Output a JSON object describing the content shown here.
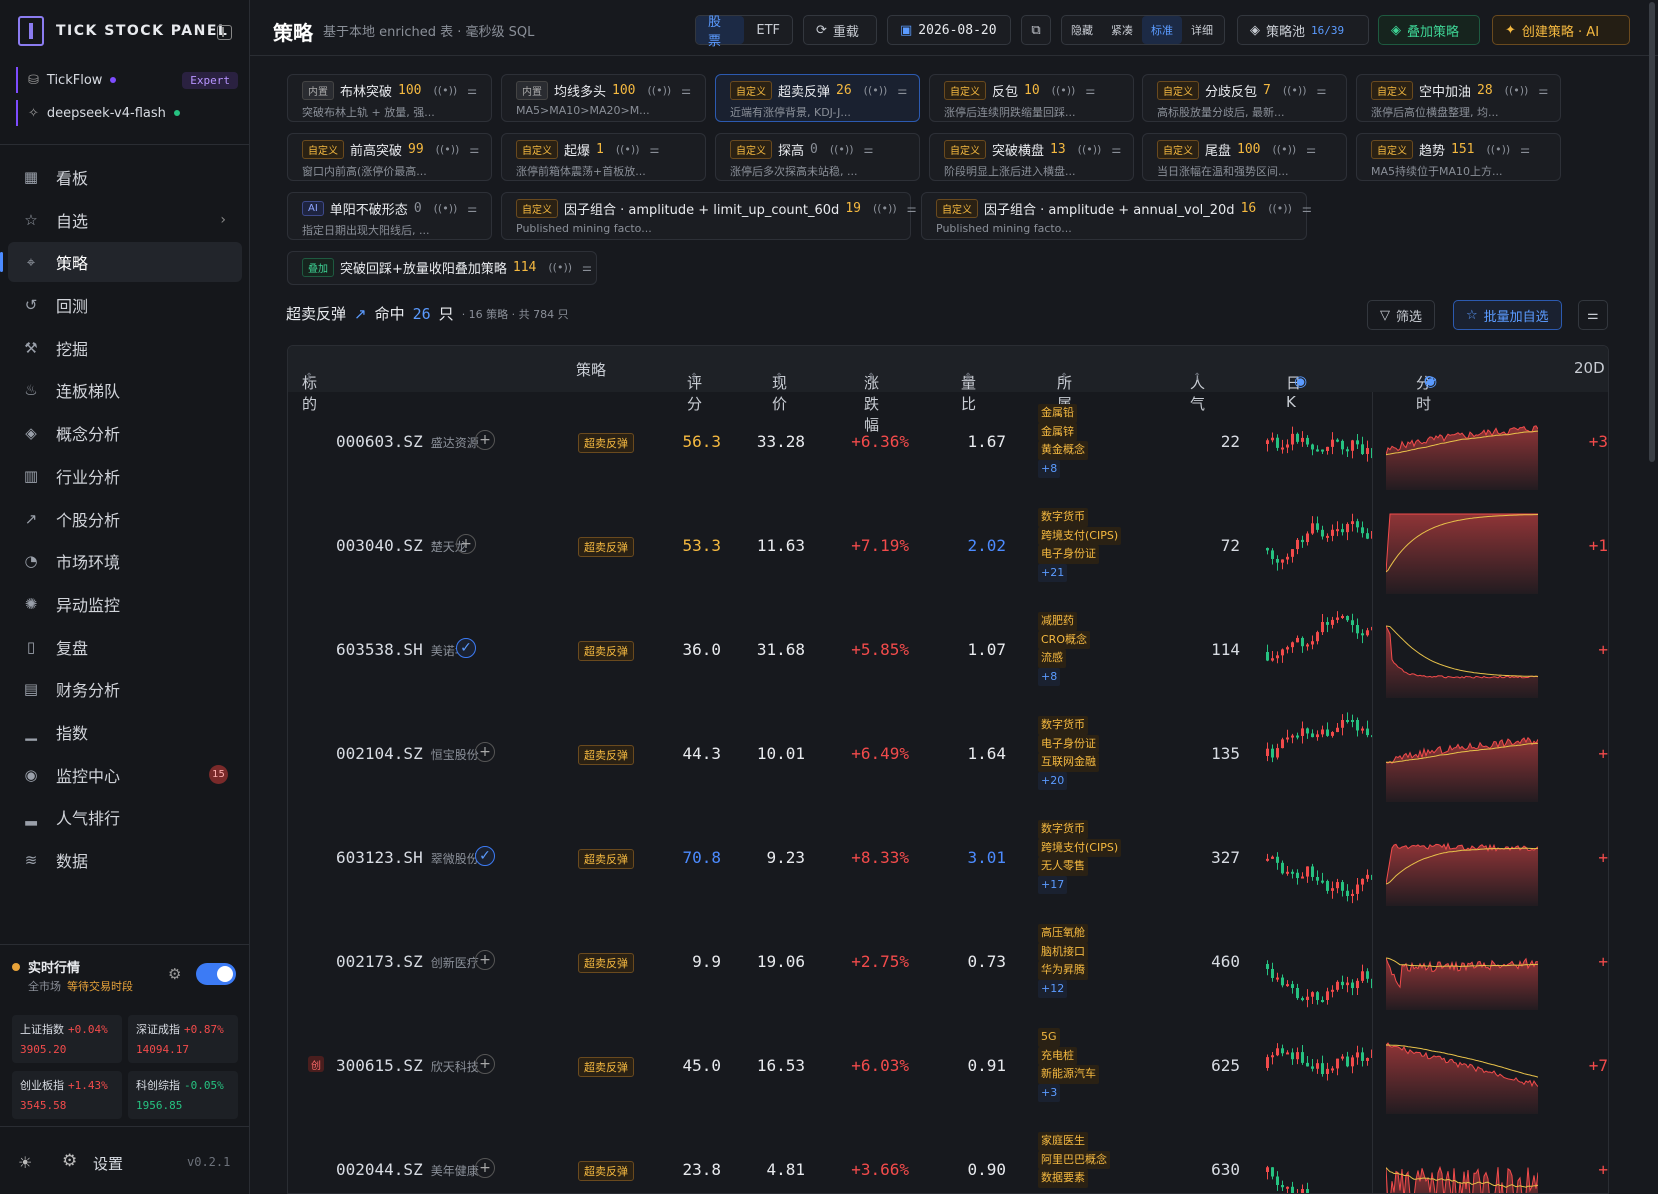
{
  "brand": "TICK STOCK PANEL",
  "accounts": [
    {
      "name": "TickFlow",
      "badge": "Expert",
      "dot": "#7d4cff"
    },
    {
      "name": "deepseek-v4-flash",
      "dot": "#26c281"
    }
  ],
  "nav": [
    {
      "label": "看板",
      "icon": "dashboard-icon",
      "glyph": "▦"
    },
    {
      "label": "自选",
      "icon": "star-icon",
      "glyph": "☆",
      "arrow": "›"
    },
    {
      "label": "策略",
      "icon": "strategy-icon",
      "glyph": "⌖",
      "active": true
    },
    {
      "label": "回测",
      "icon": "history-icon",
      "glyph": "↺"
    },
    {
      "label": "挖掘",
      "icon": "pickaxe-icon",
      "glyph": "⚒"
    },
    {
      "label": "连板梯队",
      "icon": "flame-icon",
      "glyph": "♨"
    },
    {
      "label": "概念分析",
      "icon": "layers-icon",
      "glyph": "◈"
    },
    {
      "label": "行业分析",
      "icon": "building-icon",
      "glyph": "▥"
    },
    {
      "label": "个股分析",
      "icon": "trend-icon",
      "glyph": "↗"
    },
    {
      "label": "市场环境",
      "icon": "gauge-icon",
      "glyph": "◔"
    },
    {
      "label": "异动监控",
      "icon": "alert-icon",
      "glyph": "✺"
    },
    {
      "label": "复盘",
      "icon": "book-icon",
      "glyph": "▯"
    },
    {
      "label": "财务分析",
      "icon": "document-icon",
      "glyph": "▤"
    },
    {
      "label": "指数",
      "icon": "bar-chart-icon",
      "glyph": "▁"
    },
    {
      "label": "监控中心",
      "icon": "radar-icon",
      "glyph": "◉",
      "count": "15"
    },
    {
      "label": "人气排行",
      "icon": "ranking-icon",
      "glyph": "▂"
    },
    {
      "label": "数据",
      "icon": "database-icon",
      "glyph": "≋"
    }
  ],
  "live": {
    "title": "实时行情",
    "scope": "全市场",
    "status": "等待交易时段"
  },
  "indices": [
    {
      "name": "上证指数",
      "chg": "+0.04%",
      "val": "3905.20",
      "color": "#f24b4b"
    },
    {
      "name": "深证成指",
      "chg": "+0.87%",
      "val": "14094.17",
      "color": "#f24b4b"
    },
    {
      "name": "创业板指",
      "chg": "+1.43%",
      "val": "3545.58",
      "color": "#f24b4b"
    },
    {
      "name": "科创综指",
      "chg": "-0.05%",
      "val": "1956.85",
      "color": "#26c281"
    }
  ],
  "footer": {
    "settings": "设置",
    "version": "v0.2.1"
  },
  "topbar": {
    "title": "策略",
    "subtitle": "基于本地 enriched 表 · 毫秒级 SQL",
    "seg_stock": "股票",
    "seg_etf": "ETF",
    "reload": "重载",
    "date": "2026-08-20",
    "density": [
      "隐藏",
      "紧凑",
      "标准",
      "详细"
    ],
    "pool_label": "策略池",
    "pool_count": "16/39",
    "overlay": "叠加策略",
    "create": "创建策略 · AI"
  },
  "cards": [
    {
      "tag": "内置",
      "name": "布林突破",
      "num": "100",
      "desc": "突破布林上轨 + 放量, 强..."
    },
    {
      "tag": "内置",
      "name": "均线多头",
      "num": "100",
      "desc": "MA5>MA10>MA20>M..."
    },
    {
      "tag": "自定义",
      "name": "超卖反弹",
      "num": "26",
      "desc": "近端有涨停背景, KDJ-J..."
    },
    {
      "tag": "自定义",
      "name": "反包",
      "num": "10",
      "desc": "涨停后连续阴跌缩量回踩..."
    },
    {
      "tag": "自定义",
      "name": "分歧反包",
      "num": "7",
      "desc": "高标股放量分歧后, 最新..."
    },
    {
      "tag": "自定义",
      "name": "空中加油",
      "num": "28",
      "desc": "涨停后高位横盘整理, 均..."
    },
    {
      "tag": "自定义",
      "name": "前高突破",
      "num": "99",
      "desc": "窗口内前高(涨停价最高..."
    },
    {
      "tag": "自定义",
      "name": "起爆",
      "num": "1",
      "desc": "涨停前箱体震荡+首板放..."
    },
    {
      "tag": "自定义",
      "name": "探高",
      "num": "0",
      "desc": "涨停后多次探高未站稳, ..."
    },
    {
      "tag": "自定义",
      "name": "突破横盘",
      "num": "13",
      "desc": "阶段明显上涨后进入横盘..."
    },
    {
      "tag": "自定义",
      "name": "尾盘",
      "num": "100",
      "desc": "当日涨幅在温和强势区间..."
    },
    {
      "tag": "自定义",
      "name": "趋势",
      "num": "151",
      "desc": "MA5持续位于MA10上方..."
    },
    {
      "tag": "AI",
      "name": "单阳不破形态",
      "num": "0",
      "desc": "指定日期出现大阳线后, ..."
    },
    {
      "tag": "自定义",
      "name": "因子组合 · amplitude + limit_up_count_60d",
      "num": "19",
      "desc": "Published mining facto..."
    },
    {
      "tag": "自定义",
      "name": "因子组合 · amplitude + annual_vol_20d",
      "num": "16",
      "desc": "Published mining facto..."
    },
    {
      "tag": "叠加",
      "name": "突破回踩+放量收阳叠加策略",
      "num": "114",
      "desc": ""
    }
  ],
  "hit": {
    "strategy": "超卖反弹",
    "label": "命中",
    "count": "26",
    "unit": "只",
    "meta": "· 16 策略 · 共 784 只",
    "filter": "筛选",
    "batch": "批量加自选"
  },
  "columns": [
    "标的",
    "策略",
    "评分",
    "现价",
    "涨跌幅",
    "量比",
    "所属概念",
    "人气",
    "日K",
    "分时",
    "20D"
  ],
  "rows": [
    {
      "code": "000603.SZ",
      "name": "盛达资源",
      "mark": "plus",
      "strat": "超卖反弹",
      "score": "56.3",
      "scoreColor": "#f5b940",
      "price": "33.28",
      "chg": "+6.36%",
      "vr": "1.67",
      "vrColor": "#e8eaee",
      "concepts": [
        "金属铅",
        "金属锌",
        "黄金概念"
      ],
      "more": "+8",
      "pop": "22",
      "d20": "+3",
      "intra": "up"
    },
    {
      "code": "003040.SZ",
      "name": "楚天龙",
      "mark": "plus",
      "strat": "超卖反弹",
      "score": "53.3",
      "scoreColor": "#f5b940",
      "price": "11.63",
      "chg": "+7.19%",
      "vr": "2.02",
      "vrColor": "#4c8bff",
      "concepts": [
        "数字货币",
        "跨境支付(CIPS)",
        "电子身份证"
      ],
      "more": "+21",
      "pop": "72",
      "d20": "+1",
      "intra": "limit"
    },
    {
      "code": "603538.SH",
      "name": "美诺华",
      "mark": "check",
      "strat": "超卖反弹",
      "score": "36.0",
      "scoreColor": "#e8eaee",
      "price": "31.68",
      "chg": "+5.85%",
      "vr": "1.07",
      "vrColor": "#e8eaee",
      "concepts": [
        "减肥药",
        "CRO概念",
        "流感"
      ],
      "more": "+8",
      "pop": "114",
      "d20": "+",
      "intra": "spike"
    },
    {
      "code": "002104.SZ",
      "name": "恒宝股份",
      "mark": "plus",
      "strat": "超卖反弹",
      "score": "44.3",
      "scoreColor": "#e8eaee",
      "price": "10.01",
      "chg": "+6.49%",
      "vr": "1.64",
      "vrColor": "#e8eaee",
      "concepts": [
        "数字货币",
        "电子身份证",
        "互联网金融"
      ],
      "more": "+20",
      "pop": "135",
      "d20": "+",
      "intra": "up"
    },
    {
      "code": "603123.SH",
      "name": "翠微股份",
      "mark": "check",
      "strat": "超卖反弹",
      "score": "70.8",
      "scoreColor": "#4c8bff",
      "price": "9.23",
      "chg": "+8.33%",
      "vr": "3.01",
      "vrColor": "#4c8bff",
      "concepts": [
        "数字货币",
        "跨境支付(CIPS)",
        "无人零售"
      ],
      "more": "+17",
      "pop": "327",
      "d20": "+",
      "intra": "flat"
    },
    {
      "code": "002173.SZ",
      "name": "创新医疗",
      "mark": "plus",
      "strat": "超卖反弹",
      "score": "9.9",
      "scoreColor": "#e8eaee",
      "price": "19.06",
      "chg": "+2.75%",
      "vr": "0.73",
      "vrColor": "#e8eaee",
      "concepts": [
        "高压氧舱",
        "脑机接口",
        "华为昇腾"
      ],
      "more": "+12",
      "pop": "460",
      "d20": "+",
      "intra": "dip"
    },
    {
      "code": "300615.SZ",
      "name": "欣天科技",
      "mark": "plus",
      "chuang": "创",
      "strat": "超卖反弹",
      "score": "45.0",
      "scoreColor": "#e8eaee",
      "price": "16.53",
      "chg": "+6.03%",
      "vr": "0.91",
      "vrColor": "#e8eaee",
      "concepts": [
        "5G",
        "充电桩",
        "新能源汽车"
      ],
      "more": "+3",
      "pop": "625",
      "d20": "+7",
      "intra": "down"
    },
    {
      "code": "002044.SZ",
      "name": "美年健康",
      "mark": "plus",
      "strat": "超卖反弹",
      "score": "23.8",
      "scoreColor": "#e8eaee",
      "price": "4.81",
      "chg": "+3.66%",
      "vr": "0.90",
      "vrColor": "#e8eaee",
      "concepts": [
        "家庭医生",
        "阿里巴巴概念",
        "数据要素"
      ],
      "more": "",
      "pop": "630",
      "d20": "+",
      "intra": "noisy"
    }
  ]
}
